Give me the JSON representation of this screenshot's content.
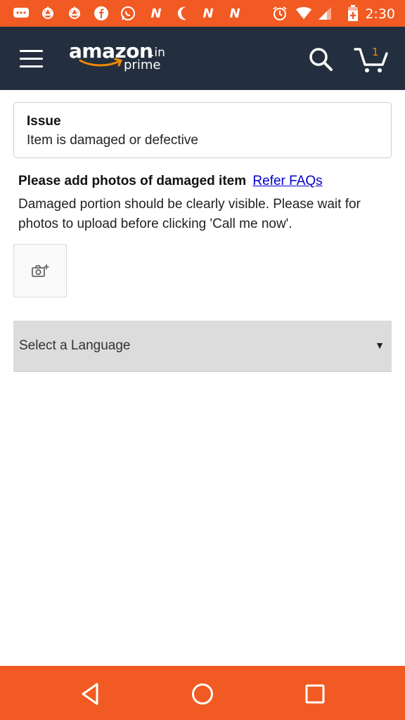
{
  "status_bar": {
    "time": "2:30",
    "icons": [
      "message-icon",
      "sync-icon",
      "sync-icon",
      "facebook-icon",
      "whatsapp-icon",
      "n-icon",
      "moon-icon",
      "n-icon",
      "n-icon",
      "alarm-icon",
      "wifi-icon",
      "signal-icon",
      "battery-icon"
    ]
  },
  "header": {
    "logo_main": "amazon",
    "logo_suffix": ".in",
    "logo_sub": "prime",
    "cart_count": "1"
  },
  "issue": {
    "title": "Issue",
    "value": "Item is damaged or defective"
  },
  "photos": {
    "heading": "Please add photos of damaged item",
    "faq_link": "Refer FAQs",
    "description": "Damaged portion should be clearly visible. Please wait for photos to upload before clicking 'Call me now'."
  },
  "language": {
    "placeholder": "Select a Language",
    "caret": "▼"
  },
  "colors": {
    "status_bar": "#f15a22",
    "header": "#232f3e",
    "accent": "#f08804",
    "link": "#0000cc"
  }
}
